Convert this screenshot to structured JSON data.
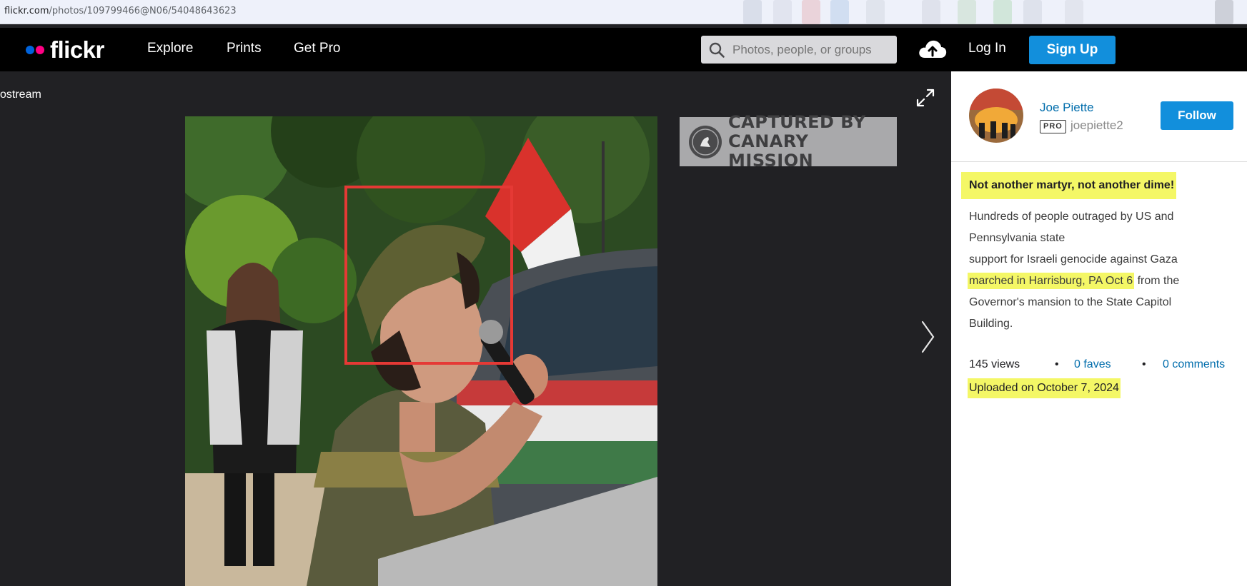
{
  "browser": {
    "url_host": "flickr.com",
    "url_path": "/photos/109799466@N06/54048643623"
  },
  "nav": {
    "logo": "flickr",
    "links": [
      "Explore",
      "Prints",
      "Get Pro"
    ],
    "search_placeholder": "Photos, people, or groups",
    "login": "Log In",
    "signup": "Sign Up"
  },
  "photo": {
    "back_label": "ostream",
    "watermark_line1": "CAPTURED BY",
    "watermark_line2": "CANARY MISSION"
  },
  "sidebar": {
    "owner_name": "Joe Piette",
    "pro_badge": "PRO",
    "handle": "joepiette2",
    "follow": "Follow",
    "title": "Not another martyr, not another dime!",
    "desc_line1": "Hundreds of people outraged by US and",
    "desc_line2": "Pennsylvania state",
    "desc_line3": "support for Israeli genocide against Gaza",
    "desc_highlight": "marched in Harrisburg, PA Oct 6",
    "desc_line4_rest": " from the",
    "desc_line5": "Governor's mansion to the State Capitol",
    "desc_line6": "Building.",
    "views": "145 views",
    "bullet": "•",
    "faves": "0 faves",
    "comments": "0 comments",
    "uploaded": "Uploaded on October 7, 2024"
  },
  "colors": {
    "flickr_blue": "#0063dc",
    "flickr_pink": "#ff0084",
    "button_blue": "#128fdc",
    "link_blue": "#006dac",
    "highlight_yellow": "#f4f766",
    "face_box_red": "#e53935"
  },
  "icons": [
    "search-icon",
    "upload-cloud-icon",
    "expand-icon",
    "next-arrow-icon",
    "canary-seal-icon"
  ]
}
